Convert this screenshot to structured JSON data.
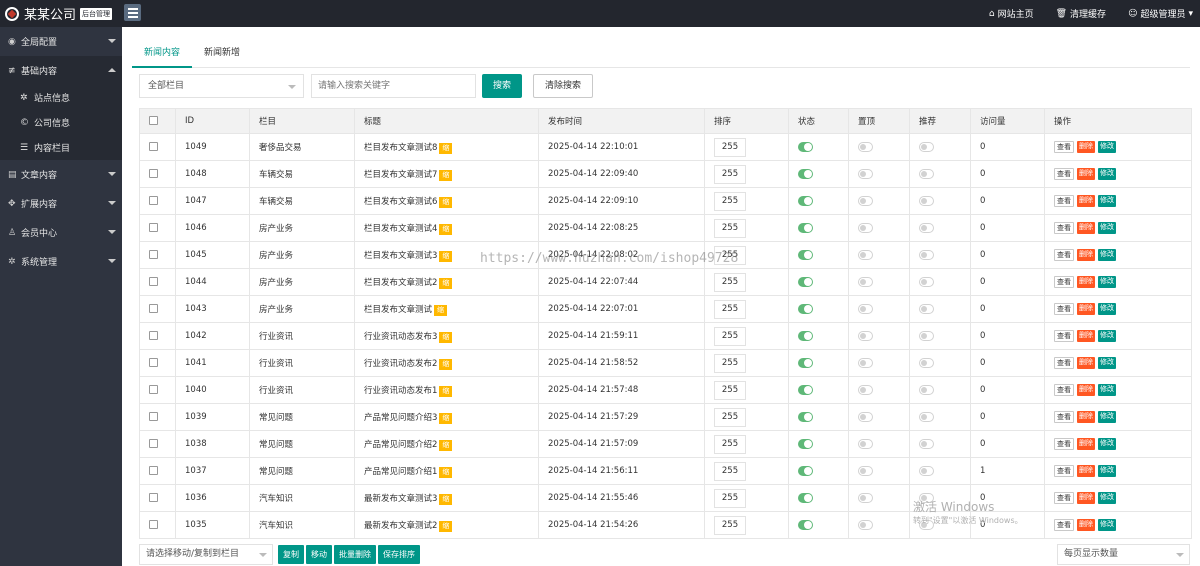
{
  "header": {
    "logo_text": "某某公司",
    "logo_tag": "后台管理",
    "links": [
      {
        "icon": "home-icon",
        "glyph": "⌂",
        "label": "网站主页"
      },
      {
        "icon": "trash-icon",
        "glyph": "🗑",
        "label": "清理缓存"
      },
      {
        "icon": "user-icon",
        "glyph": "☺",
        "label": "超级管理员"
      }
    ]
  },
  "sidebar": {
    "items": [
      {
        "icon": "globe-icon",
        "glyph": "◉",
        "label": "全局配置",
        "open": false,
        "children": []
      },
      {
        "icon": "sliders-icon",
        "glyph": "≢",
        "label": "基础内容",
        "open": true,
        "children": [
          {
            "icon": "gear-icon",
            "glyph": "✲",
            "label": "站点信息"
          },
          {
            "icon": "copyright-icon",
            "glyph": "©",
            "label": "公司信息"
          },
          {
            "icon": "list-icon",
            "glyph": "☰",
            "label": "内容栏目"
          }
        ]
      },
      {
        "icon": "file-icon",
        "glyph": "▤",
        "label": "文章内容",
        "open": false,
        "children": []
      },
      {
        "icon": "expand-icon",
        "glyph": "✥",
        "label": "扩展内容",
        "open": false,
        "children": []
      },
      {
        "icon": "user-icon",
        "glyph": "♙",
        "label": "会员中心",
        "open": false,
        "children": []
      },
      {
        "icon": "gear-icon",
        "glyph": "✲",
        "label": "系统管理",
        "open": false,
        "children": []
      }
    ]
  },
  "tabs": [
    "新闻内容",
    "新闻新增"
  ],
  "filters": {
    "category_select": "全部栏目",
    "search_placeholder": "请输入搜索关键字",
    "search_button": "搜索",
    "clear_button": "清除搜索"
  },
  "table": {
    "headers": [
      "ID",
      "栏目",
      "标题",
      "发布时间",
      "排序",
      "状态",
      "置顶",
      "推荐",
      "访问量",
      "操作"
    ],
    "new_badge": "缩",
    "actions": {
      "view": "查看",
      "delete": "删除",
      "edit": "修改"
    },
    "rows": [
      {
        "id": "1049",
        "category": "奢侈品交易",
        "title": "栏目发布文章测试8",
        "time": "2025-04-14 22:10:01",
        "sort": "255",
        "status": true,
        "top": false,
        "recommend": false,
        "visits": "0"
      },
      {
        "id": "1048",
        "category": "车辆交易",
        "title": "栏目发布文章测试7",
        "time": "2025-04-14 22:09:40",
        "sort": "255",
        "status": true,
        "top": false,
        "recommend": false,
        "visits": "0"
      },
      {
        "id": "1047",
        "category": "车辆交易",
        "title": "栏目发布文章测试6",
        "time": "2025-04-14 22:09:10",
        "sort": "255",
        "status": true,
        "top": false,
        "recommend": false,
        "visits": "0"
      },
      {
        "id": "1046",
        "category": "房产业务",
        "title": "栏目发布文章测试4",
        "time": "2025-04-14 22:08:25",
        "sort": "255",
        "status": true,
        "top": false,
        "recommend": false,
        "visits": "0"
      },
      {
        "id": "1045",
        "category": "房产业务",
        "title": "栏目发布文章测试3",
        "time": "2025-04-14 22:08:02",
        "sort": "255",
        "status": true,
        "top": false,
        "recommend": false,
        "visits": "0"
      },
      {
        "id": "1044",
        "category": "房产业务",
        "title": "栏目发布文章测试2",
        "time": "2025-04-14 22:07:44",
        "sort": "255",
        "status": true,
        "top": false,
        "recommend": false,
        "visits": "0"
      },
      {
        "id": "1043",
        "category": "房产业务",
        "title": "栏目发布文章测试",
        "time": "2025-04-14 22:07:01",
        "sort": "255",
        "status": true,
        "top": false,
        "recommend": false,
        "visits": "0"
      },
      {
        "id": "1042",
        "category": "行业资讯",
        "title": "行业资讯动态发布3",
        "time": "2025-04-14 21:59:11",
        "sort": "255",
        "status": true,
        "top": false,
        "recommend": false,
        "visits": "0"
      },
      {
        "id": "1041",
        "category": "行业资讯",
        "title": "行业资讯动态发布2",
        "time": "2025-04-14 21:58:52",
        "sort": "255",
        "status": true,
        "top": false,
        "recommend": false,
        "visits": "0"
      },
      {
        "id": "1040",
        "category": "行业资讯",
        "title": "行业资讯动态发布1",
        "time": "2025-04-14 21:57:48",
        "sort": "255",
        "status": true,
        "top": false,
        "recommend": false,
        "visits": "0"
      },
      {
        "id": "1039",
        "category": "常见问题",
        "title": "产品常见问题介绍3",
        "time": "2025-04-14 21:57:29",
        "sort": "255",
        "status": true,
        "top": false,
        "recommend": false,
        "visits": "0"
      },
      {
        "id": "1038",
        "category": "常见问题",
        "title": "产品常见问题介绍2",
        "time": "2025-04-14 21:57:09",
        "sort": "255",
        "status": true,
        "top": false,
        "recommend": false,
        "visits": "0"
      },
      {
        "id": "1037",
        "category": "常见问题",
        "title": "产品常见问题介绍1",
        "time": "2025-04-14 21:56:11",
        "sort": "255",
        "status": true,
        "top": false,
        "recommend": false,
        "visits": "1"
      },
      {
        "id": "1036",
        "category": "汽车知识",
        "title": "最新发布文章测试3",
        "time": "2025-04-14 21:55:46",
        "sort": "255",
        "status": true,
        "top": false,
        "recommend": false,
        "visits": "0"
      },
      {
        "id": "1035",
        "category": "汽车知识",
        "title": "最新发布文章测试2",
        "time": "2025-04-14 21:54:26",
        "sort": "255",
        "status": true,
        "top": false,
        "recommend": false,
        "visits": "0"
      }
    ]
  },
  "footer": {
    "move_select": "请选择移动/复制到栏目",
    "buttons": [
      "复制",
      "移动",
      "批量删除",
      "保存排序"
    ],
    "per_page": "每页显示数量"
  },
  "watermark": "https://www.huzhan.com/ishop49728",
  "windows_watermark": {
    "line1": "激活 Windows",
    "line2": "转到\"设置\"以激活 Windows。"
  }
}
